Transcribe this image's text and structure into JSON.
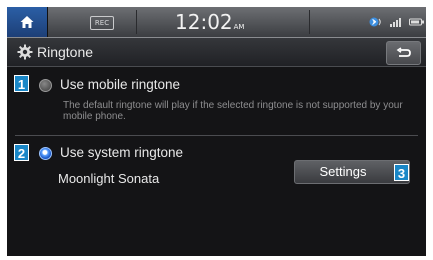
{
  "status_bar": {
    "home_icon": "home-icon",
    "rec_label": "REC",
    "time": "12:02",
    "ampm": "AM",
    "icons": [
      "bluetooth-audio-icon",
      "signal-strength-icon",
      "battery-icon"
    ]
  },
  "header": {
    "icon": "gear-icon",
    "title": "Ringtone",
    "back_icon": "back-arrow-icon"
  },
  "options": [
    {
      "marker": "1",
      "label": "Use mobile ringtone",
      "selected": false,
      "description": "The default ringtone will play if the selected ringtone is not supported by your mobile phone."
    },
    {
      "marker": "2",
      "label": "Use system ringtone",
      "selected": true,
      "current_ringtone": "Moonlight Sonata"
    }
  ],
  "settings_button": {
    "label": "Settings",
    "marker": "3"
  },
  "colors": {
    "accent": "#1a87c7",
    "radio_selected": "#2f7bea"
  }
}
